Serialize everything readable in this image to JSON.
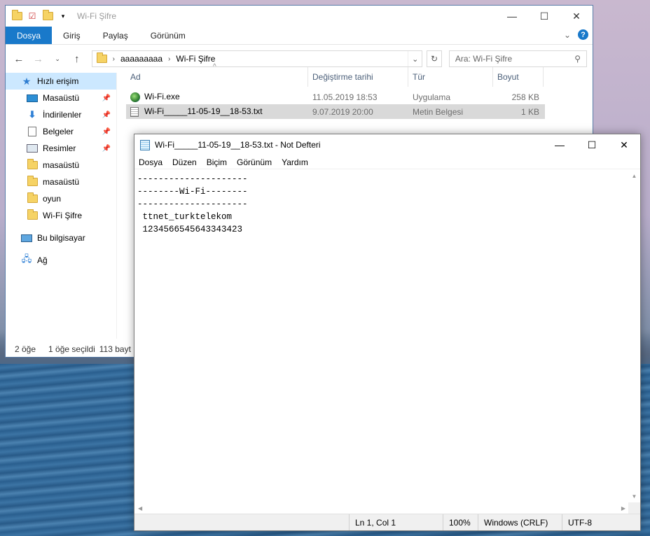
{
  "explorer": {
    "title": "Wi-Fi Şifre",
    "ribbon_tabs": [
      "Dosya",
      "Giriş",
      "Paylaş",
      "Görünüm"
    ],
    "breadcrumb": [
      "aaaaaaaaa",
      "Wi-Fi Şifre"
    ],
    "search_placeholder": "Ara: Wi-Fi Şifre",
    "sidebar": {
      "quick_access": "Hızlı erişim",
      "items": [
        {
          "label": "Masaüstü",
          "icon": "desktop-icon",
          "pinned": true
        },
        {
          "label": "İndirilenler",
          "icon": "download-icon",
          "pinned": true
        },
        {
          "label": "Belgeler",
          "icon": "documents-icon",
          "pinned": true
        },
        {
          "label": "Resimler",
          "icon": "pictures-icon",
          "pinned": true
        },
        {
          "label": "masaüstü",
          "icon": "folder-icon",
          "pinned": false
        },
        {
          "label": "masaüstü",
          "icon": "folder-icon",
          "pinned": false
        },
        {
          "label": "oyun",
          "icon": "folder-icon",
          "pinned": false
        },
        {
          "label": "Wi-Fi Şifre",
          "icon": "folder-icon",
          "pinned": false
        }
      ],
      "this_pc": "Bu bilgisayar",
      "network": "Ağ"
    },
    "columns": {
      "name": "Ad",
      "date": "Değiştirme tarihi",
      "type": "Tür",
      "size": "Boyut"
    },
    "files": [
      {
        "name": "Wi-Fi.exe",
        "date": "11.05.2019 18:53",
        "type": "Uygulama",
        "size": "258 KB",
        "icon": "exe-globe-icon"
      },
      {
        "name": "Wi-Fi_____11-05-19__18-53.txt",
        "date": "9.07.2019 20:00",
        "type": "Metin Belgesi",
        "size": "1 KB",
        "icon": "text-file-icon"
      }
    ],
    "status": {
      "count": "2 öğe",
      "selected": "1 öğe seçildi",
      "size": "113 bayt"
    }
  },
  "notepad": {
    "title": "Wi-Fi_____11-05-19__18-53.txt - Not Defteri",
    "menu": [
      "Dosya",
      "Düzen",
      "Biçim",
      "Görünüm",
      "Yardım"
    ],
    "content": "---------------------\n--------Wi-Fi--------\n---------------------\n ttnet_turktelekom\n 1234566545643343423",
    "status": {
      "position": "Ln 1, Col 1",
      "zoom": "100%",
      "line_ending": "Windows (CRLF)",
      "encoding": "UTF-8"
    }
  }
}
